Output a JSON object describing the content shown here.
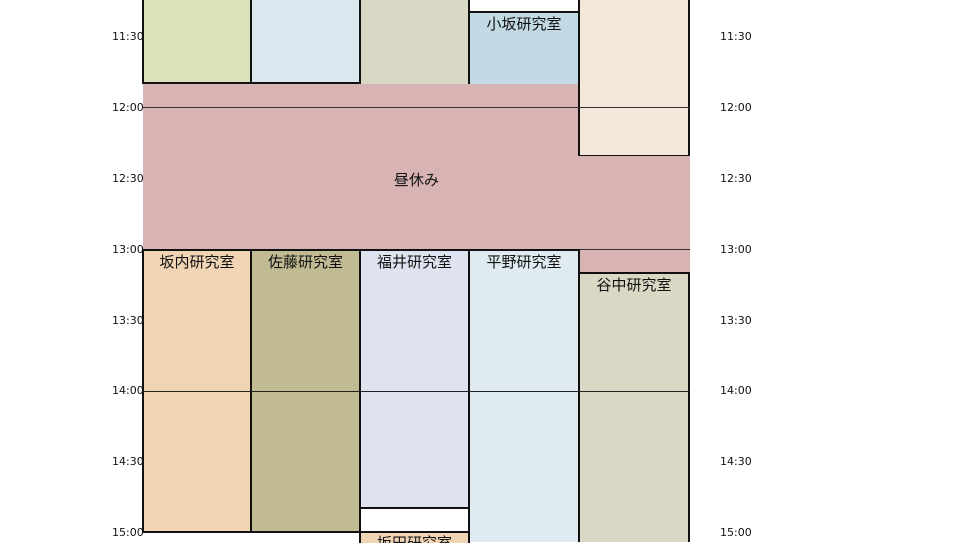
{
  "time_labels": [
    "11:30",
    "12:00",
    "12:30",
    "13:00",
    "13:30",
    "14:00",
    "14:30",
    "15:00"
  ],
  "lunch": {
    "label": "昼休み",
    "color": "#d8b3b4"
  },
  "morning_blocks": [
    {
      "label": "",
      "color": "#d9e2bb"
    },
    {
      "label": "",
      "color": "#dce8ef"
    },
    {
      "label": "",
      "color": "#d9d8c5"
    },
    {
      "label": "小坂研究室",
      "color": "#c3d9e3"
    },
    {
      "label": "",
      "color": "#f5e6da"
    }
  ],
  "afternoon_blocks": [
    {
      "label": "坂内研究室",
      "color": "#f0d4b4"
    },
    {
      "label": "佐藤研究室",
      "color": "#c0bb93"
    },
    {
      "label": "福井研究室",
      "color": "#dfe3ef"
    },
    {
      "label": "平野研究室",
      "color": "#dfebf1"
    },
    {
      "label": "谷中研究室",
      "color": "#d9d8c5"
    }
  ],
  "partial_block": {
    "label": "坂田研究室",
    "color": "#f0d4b4"
  }
}
